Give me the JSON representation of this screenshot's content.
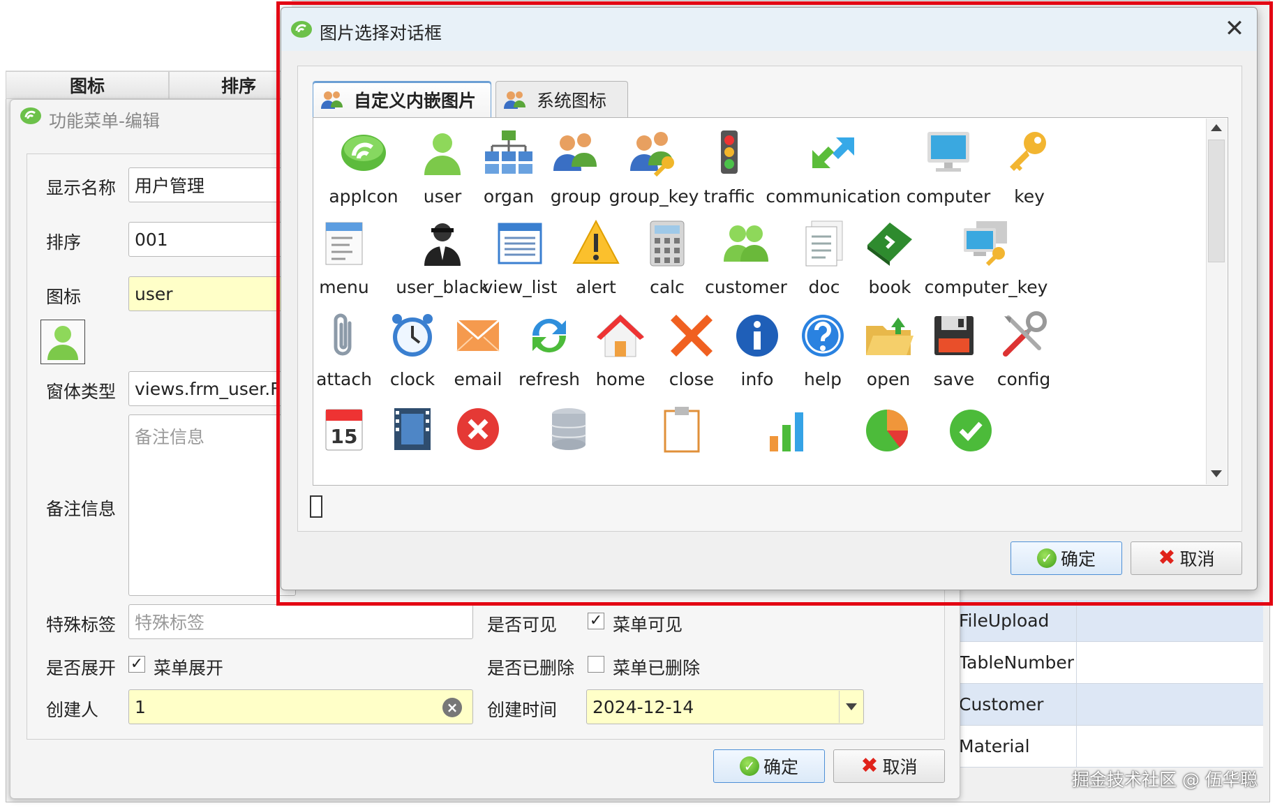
{
  "background_grid": {
    "headers": [
      "图标",
      "排序"
    ],
    "rows": [
      "FileUpload",
      "TableNumber",
      "Customer",
      "Material"
    ]
  },
  "editor": {
    "title": "功能菜单-编辑",
    "fields": {
      "display_name_label": "显示名称",
      "display_name_value": "用户管理",
      "order_label": "排序",
      "order_value": "001",
      "icon_label": "图标",
      "icon_value": "user",
      "form_type_label": "窗体类型",
      "form_type_value": "views.frm_user.Frm",
      "remark_label": "备注信息",
      "remark_placeholder": "备注信息",
      "special_tag_label": "特殊标签",
      "special_tag_placeholder": "特殊标签",
      "visible_label": "是否可见",
      "visible_checkbox_label": "菜单可见",
      "visible_checked": true,
      "expand_label": "是否展开",
      "expand_checkbox_label": "菜单展开",
      "expand_checked": true,
      "deleted_label": "是否已删除",
      "deleted_checkbox_label": "菜单已删除",
      "deleted_checked": false,
      "creator_label": "创建人",
      "creator_value": "1",
      "created_time_label": "创建时间",
      "created_time_value": "2024-12-14"
    },
    "ok_label": "确定",
    "cancel_label": "取消"
  },
  "dialog": {
    "title": "图片选择对话框",
    "tabs": [
      "自定义内嵌图片",
      "系统图标"
    ],
    "active_tab": 0,
    "icons_row1": [
      "appIcon",
      "user",
      "organ",
      "group",
      "group_key",
      "traffic",
      "communication",
      "computer",
      "key"
    ],
    "icons_row2": [
      "menu",
      "user_black",
      "view_list",
      "alert",
      "calc",
      "customer",
      "doc",
      "book",
      "computer_key"
    ],
    "icons_row3": [
      "attach",
      "clock",
      "email",
      "refresh",
      "home",
      "close",
      "info",
      "help",
      "open",
      "save",
      "config"
    ],
    "calendar_day": "15",
    "ok_label": "确定",
    "cancel_label": "取消"
  },
  "watermark": "掘金技术社区 @ 伍华聪",
  "colors": {
    "highlight": "#e30613",
    "selection_bg": "#dde7f5",
    "input_yellow": "#ffffc8",
    "accent_border": "#4d8fd6"
  }
}
